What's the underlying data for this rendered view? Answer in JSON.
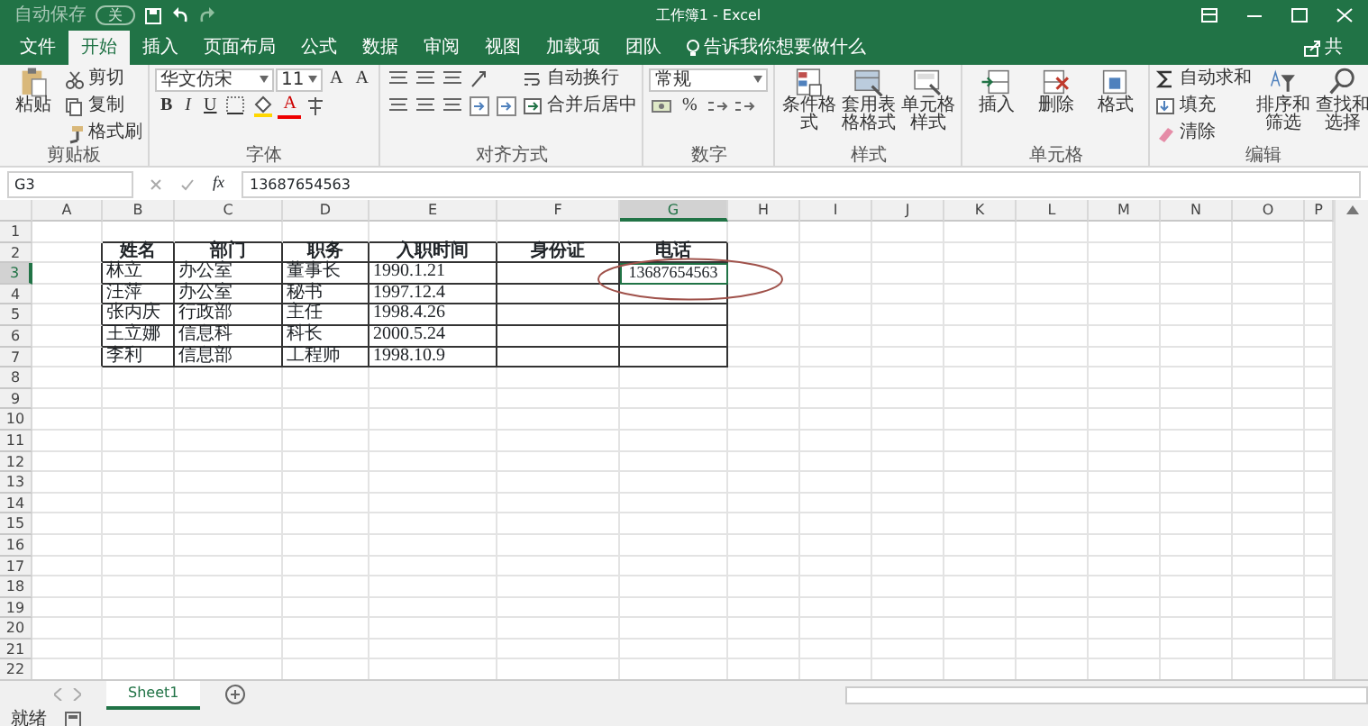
{
  "title_bar": {
    "autosave_label": "自动保存",
    "autosave_state": "关",
    "autosave_on": false,
    "title": "工作簿1 - Excel"
  },
  "tabs": [
    {
      "label": "文件",
      "selected": false
    },
    {
      "label": "开始",
      "selected": true
    },
    {
      "label": "插入",
      "selected": false
    },
    {
      "label": "页面布局",
      "selected": false
    },
    {
      "label": "公式",
      "selected": false
    },
    {
      "label": "数据",
      "selected": false
    },
    {
      "label": "审阅",
      "selected": false
    },
    {
      "label": "视图",
      "selected": false
    },
    {
      "label": "加载项",
      "selected": false
    },
    {
      "label": "团队",
      "selected": false
    }
  ],
  "tell_me": "告诉我你想要做什么",
  "share": "共",
  "ribbon": [
    {
      "label": "剪贴板",
      "columns": [
        [
          [
            {
              "kind": "big",
              "label": "粘贴"
            }
          ]
        ],
        [
          [
            {
              "kind": "small",
              "label": "剪切"
            }
          ],
          [
            {
              "kind": "small",
              "label": "复制"
            }
          ],
          [
            {
              "kind": "small",
              "label": "格式刷"
            }
          ]
        ]
      ]
    },
    {
      "label": "字体",
      "columns": [
        [
          [
            {
              "kind": "select",
              "value": "华文仿宋",
              "wide": true
            },
            {
              "kind": "select",
              "value": "11",
              "wide": false
            },
            {
              "kind": "glyph",
              "text": "A"
            },
            {
              "kind": "glyph",
              "text": "A"
            }
          ],
          [
            {
              "kind": "glyph",
              "text": "B"
            },
            {
              "kind": "glyph",
              "text": "I"
            },
            {
              "kind": "glyph",
              "text": "U"
            },
            {
              "kind": "border"
            },
            {
              "kind": "fill"
            },
            {
              "kind": "fontcolor",
              "text": "A"
            },
            {
              "kind": "phonetic"
            }
          ]
        ]
      ]
    },
    {
      "label": "对齐方式",
      "columns": [
        [
          [
            {
              "kind": "align"
            },
            {
              "kind": "align"
            },
            {
              "kind": "align"
            },
            {
              "kind": "orient"
            }
          ],
          [
            {
              "kind": "align"
            },
            {
              "kind": "align"
            },
            {
              "kind": "align"
            },
            {
              "kind": "indent"
            },
            {
              "kind": "indent"
            }
          ]
        ],
        [
          [
            {
              "kind": "small",
              "label": "自动换行"
            }
          ],
          [
            {
              "kind": "small",
              "label": "合并后居中"
            }
          ]
        ]
      ]
    },
    {
      "label": "数字",
      "columns": [
        [
          [
            {
              "kind": "select",
              "value": "常规",
              "wide": true
            }
          ],
          [
            {
              "kind": "currency"
            },
            {
              "kind": "glyph",
              "text": "%"
            },
            {
              "kind": "decimal"
            },
            {
              "kind": "decimal"
            }
          ]
        ]
      ]
    },
    {
      "label": "样式",
      "columns": [
        [
          [
            {
              "kind": "big",
              "label": "条件格式"
            }
          ]
        ],
        [
          [
            {
              "kind": "big",
              "label": "套用表格格式"
            }
          ]
        ],
        [
          [
            {
              "kind": "big",
              "label": "单元格样式"
            }
          ]
        ]
      ]
    },
    {
      "label": "单元格",
      "columns": [
        [
          [
            {
              "kind": "big",
              "label": "插入"
            }
          ]
        ],
        [
          [
            {
              "kind": "big",
              "label": "删除"
            }
          ]
        ],
        [
          [
            {
              "kind": "big",
              "label": "格式"
            }
          ]
        ]
      ]
    },
    {
      "label": "编辑",
      "columns": [
        [
          [
            {
              "kind": "small",
              "label": "自动求和"
            }
          ],
          [
            {
              "kind": "small",
              "label": "填充"
            }
          ],
          [
            {
              "kind": "small",
              "label": "清除"
            }
          ]
        ],
        [
          [
            {
              "kind": "big",
              "label": "排序和筛选"
            }
          ]
        ],
        [
          [
            {
              "kind": "big",
              "label": "查找和选择"
            }
          ]
        ]
      ]
    }
  ],
  "formula_bar": {
    "name_box": "G3",
    "function_label": "fx",
    "formula": "13687654563"
  },
  "columns": [
    {
      "label": "A",
      "selected": false
    },
    {
      "label": "B",
      "selected": false
    },
    {
      "label": "C",
      "selected": false
    },
    {
      "label": "D",
      "selected": false
    },
    {
      "label": "E",
      "selected": false
    },
    {
      "label": "F",
      "selected": false
    },
    {
      "label": "G",
      "selected": true
    },
    {
      "label": "H",
      "selected": false
    },
    {
      "label": "I",
      "selected": false
    },
    {
      "label": "J",
      "selected": false
    },
    {
      "label": "K",
      "selected": false
    },
    {
      "label": "L",
      "selected": false
    },
    {
      "label": "M",
      "selected": false
    },
    {
      "label": "N",
      "selected": false
    },
    {
      "label": "O",
      "selected": false
    },
    {
      "label": "P",
      "selected": false
    }
  ],
  "rows": [
    {
      "label": "1",
      "selected": false
    },
    {
      "label": "2",
      "selected": false
    },
    {
      "label": "3",
      "selected": true
    },
    {
      "label": "4",
      "selected": false
    },
    {
      "label": "5",
      "selected": false
    },
    {
      "label": "6",
      "selected": false
    },
    {
      "label": "7",
      "selected": false
    },
    {
      "label": "8",
      "selected": false
    },
    {
      "label": "9",
      "selected": false
    },
    {
      "label": "10",
      "selected": false
    },
    {
      "label": "11",
      "selected": false
    },
    {
      "label": "12",
      "selected": false
    },
    {
      "label": "13",
      "selected": false
    },
    {
      "label": "14",
      "selected": false
    },
    {
      "label": "15",
      "selected": false
    },
    {
      "label": "16",
      "selected": false
    },
    {
      "label": "17",
      "selected": false
    },
    {
      "label": "18",
      "selected": false
    },
    {
      "label": "19",
      "selected": false
    },
    {
      "label": "20",
      "selected": false
    },
    {
      "label": "21",
      "selected": false
    },
    {
      "label": "22",
      "selected": false
    }
  ],
  "table": {
    "header": [
      "姓名",
      "部门",
      "职务",
      "入职时间",
      "身份证",
      "电话"
    ],
    "rows": [
      [
        "林立",
        "办公室",
        "董事长",
        "1990.1.21",
        "",
        "13687654563"
      ],
      [
        "汪萍",
        "办公室",
        "秘书",
        "1997.12.4",
        "",
        ""
      ],
      [
        "张丙庆",
        "行政部",
        "主任",
        "1998.4.26",
        "",
        ""
      ],
      [
        "王立娜",
        "信息科",
        "科长",
        "2000.5.24",
        "",
        ""
      ],
      [
        "李利",
        "信息部",
        "工程师",
        "1998.10.9",
        "",
        ""
      ]
    ]
  },
  "annotation": {
    "kind": "ellipse"
  },
  "sheet_tabs": [
    {
      "label": "Sheet1",
      "selected": true
    }
  ],
  "status": "就绪"
}
